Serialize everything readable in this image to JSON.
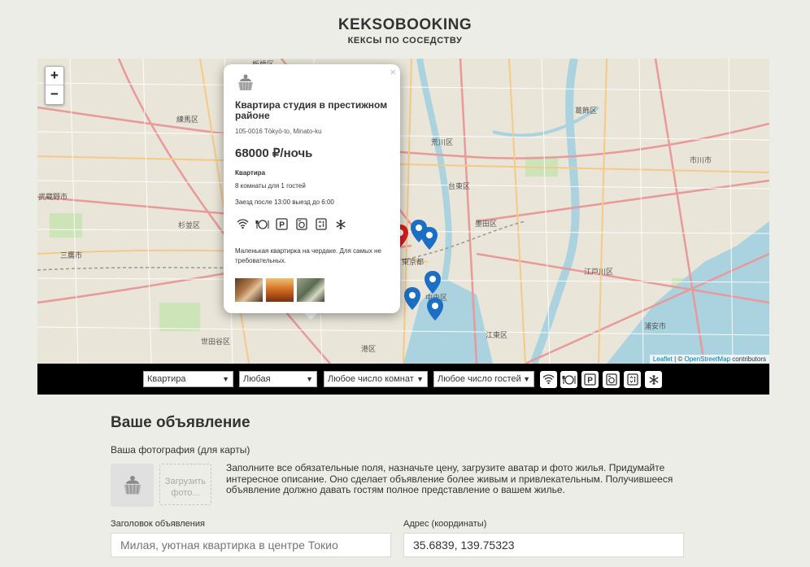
{
  "header": {
    "logo": "KEKSOBOOKING",
    "subtitle": "КЕКСЫ ПО СОСЕДСТВУ"
  },
  "map": {
    "zoom_in": "+",
    "zoom_out": "−",
    "labels": [
      "板橋区",
      "練馬区",
      "武蔵野市",
      "杉並区",
      "三鷹市",
      "世田谷区",
      "港区",
      "荒川区",
      "台東区",
      "墨田区",
      "葛飾区",
      "市川市",
      "江戸川区",
      "中央区",
      "江東区",
      "浦安市",
      "東京都"
    ],
    "attribution": {
      "leaflet": "Leaflet",
      "separator": " | © ",
      "osm": "OpenStreetMap",
      "suffix": " contributors"
    }
  },
  "popup": {
    "close": "×",
    "title": "Квартира студия в престижном районе",
    "address": "105-0016 Tōkyō-to, Minato-ku",
    "price": "68000 ₽/ночь",
    "type": "Квартира",
    "capacity": "8 комнаты для 1 гостей",
    "time": "Заезд после 13:00 выезд до 6:00",
    "features": [
      "wifi-icon",
      "dishwasher-icon",
      "parking-icon",
      "washer-icon",
      "elevator-icon",
      "conditioner-icon"
    ],
    "description": "Маленькая квартирка на чердаке. Для самых не требовательных."
  },
  "filters": {
    "housing_type": "Квартира",
    "price": "Любая",
    "rooms": "Любое число комнат",
    "guests": "Любое число гостей",
    "features": [
      "wifi-icon",
      "dishwasher-icon",
      "parking-icon",
      "washer-icon",
      "elevator-icon",
      "conditioner-icon"
    ]
  },
  "form": {
    "title": "Ваше объявление",
    "photo_label": "Ваша фотография (для карты)",
    "upload_label": "Загрузить фото...",
    "note": "Заполните все обязательные поля, назначьте цену, загрузите аватар и фото жилья. Придумайте интересное описание. Оно сделает объявление более живым и привлекательным. Получившееся объявление должно давать гостям полное представление о вашем жилье.",
    "title_label": "Заголовок объявления",
    "title_placeholder": "Милая, уютная квартирка в центре Токио",
    "address_label": "Адрес (координаты)",
    "address_value": "35.6839, 139.75323"
  },
  "colors": {
    "background": "#ecede7",
    "pin_blue": "#1b6fc4",
    "pin_red": "#d42020",
    "filter_bar": "#000000"
  }
}
